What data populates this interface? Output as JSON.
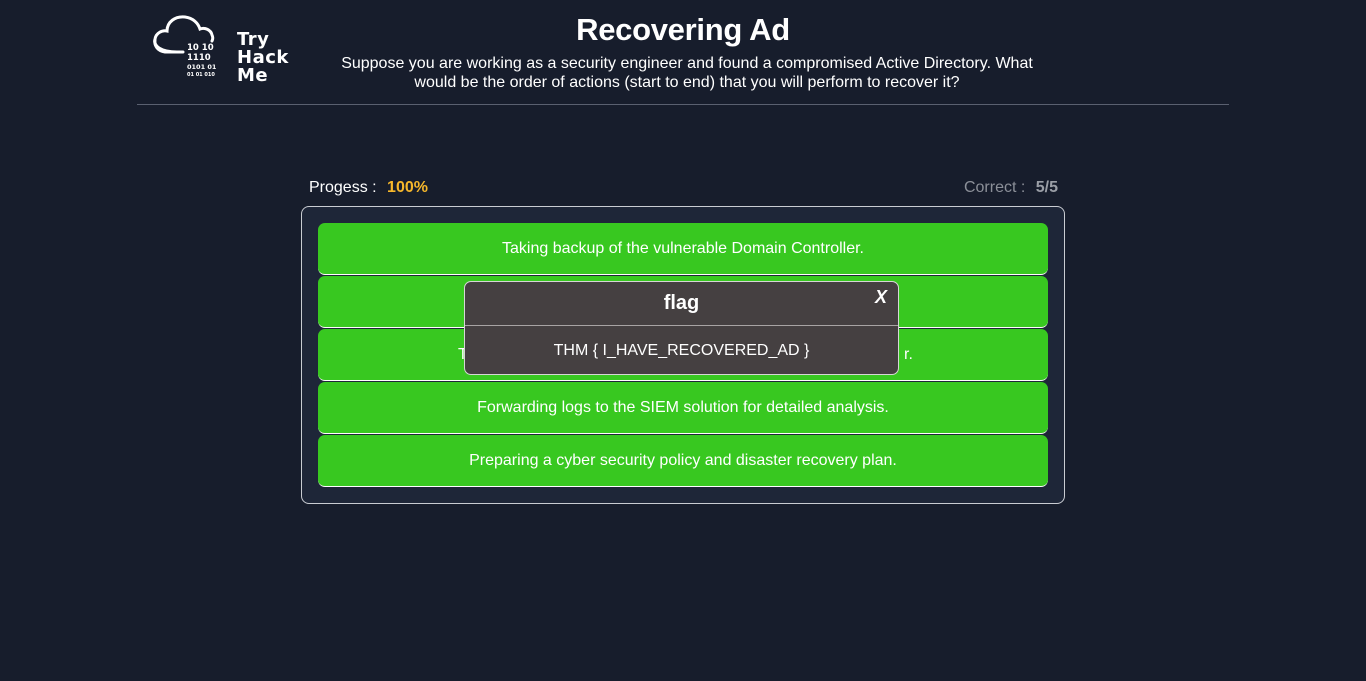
{
  "logo": {
    "icon": "cloud-binary-icon",
    "line1": "Try",
    "line2": "Hack",
    "line3": "Me",
    "binary": [
      "10 10",
      "1110",
      "0101 01",
      "01 01 010"
    ]
  },
  "header": {
    "title": "Recovering Ad",
    "subtitle": "Suppose you are working as a security engineer and found a compromised Active Directory. What would be the order of actions (start to end) that you will perform to recover it?"
  },
  "progress": {
    "label": "Progess :",
    "value": "100%",
    "value_fraction": 1.0
  },
  "correct": {
    "label": "Correct :",
    "value": "5/5"
  },
  "answers": [
    {
      "label": "Taking backup of the vulnerable Domain Controller.",
      "visible_text": "Taking backup of the vulnerable Domain Controller."
    },
    {
      "label": "",
      "visible_text": ""
    },
    {
      "label_left": "T",
      "label_right": "r.",
      "visible_text": ""
    },
    {
      "label": "Forwarding logs to the SIEM solution for detailed analysis.",
      "visible_text": "Forwarding logs to the SIEM solution for detailed analysis."
    },
    {
      "label": "Preparing a cyber security policy and disaster recovery plan.",
      "visible_text": "Preparing a cyber security policy and disaster recovery plan."
    }
  ],
  "modal": {
    "title": "flag",
    "close_label": "X",
    "body": "THM { I_HAVE_RECOVERED_AD }"
  },
  "colors": {
    "background": "#171d2c",
    "answer_correct": "#38c820",
    "progress_accent": "#f6b72b",
    "modal_bg": "#454041"
  }
}
